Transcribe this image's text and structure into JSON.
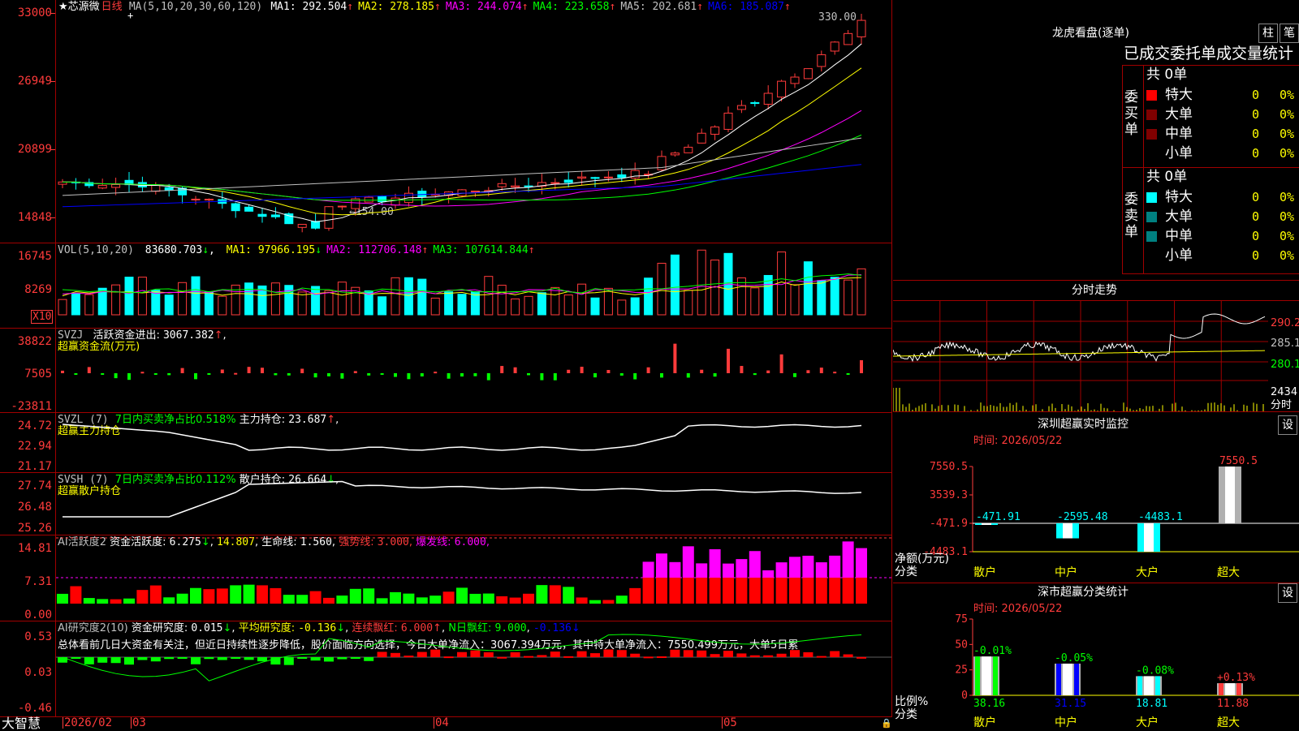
{
  "stock": {
    "name": "芯源微",
    "period": "日线",
    "star": "★"
  },
  "kline": {
    "ma_params": "MA(5,10,20,30,60,120)",
    "ma": [
      {
        "label": "MA1:",
        "value": "292.504",
        "arrow": "↑",
        "color": "#ffffff"
      },
      {
        "label": "MA2:",
        "value": "278.185",
        "arrow": "↑",
        "color": "#ffff00"
      },
      {
        "label": "MA3:",
        "value": "244.074",
        "arrow": "↑",
        "color": "#ff00ff"
      },
      {
        "label": "MA4:",
        "value": "223.658",
        "arrow": "↑",
        "color": "#00ff00"
      },
      {
        "label": "MA5:",
        "value": "202.681",
        "arrow": "↑",
        "color": "#c0c0c0"
      },
      {
        "label": "MA6:",
        "value": "185.087",
        "arrow": "↑",
        "color": "#0000ff"
      }
    ],
    "y_ticks": [
      "33000",
      "26949",
      "20899",
      "14848"
    ],
    "high_label": "330.00",
    "low_label": "←154.00"
  },
  "vol": {
    "title": "VOL(5,10,20)",
    "value": "83680.703",
    "value_arrow": "↓",
    "ma": [
      {
        "label": "MA1:",
        "value": "97966.195",
        "arrow": "↓",
        "color": "#ffff00"
      },
      {
        "label": "MA2:",
        "value": "112706.148",
        "arrow": "↑",
        "color": "#ff00ff"
      },
      {
        "label": "MA3:",
        "value": "107614.844",
        "arrow": "↑",
        "color": "#00ff00"
      }
    ],
    "y_ticks": [
      "16745",
      "8269"
    ],
    "unit": "X10"
  },
  "svzj": {
    "title": "SVZJ",
    "label": "活跃资金进出:",
    "value": "3067.382",
    "arrow": "↑",
    "sub": "超赢资金流(万元)",
    "y_ticks": [
      "38822",
      "7505",
      "-23811"
    ]
  },
  "svzl": {
    "title": "SVZL (7)",
    "green_text": "7日内买卖净占比0.518%",
    "label": "主力持仓:",
    "value": "23.687",
    "arrow": "↑",
    "sub": "超赢主力持仓",
    "y_ticks": [
      "24.72",
      "22.94",
      "21.17"
    ]
  },
  "svsh": {
    "title": "SVSH (7)",
    "green_text": "7日内买卖净占比0.112%",
    "label": "散户持仓:",
    "value": "26.664",
    "arrow": "↓",
    "sub": "超赢散户持仓",
    "y_ticks": [
      "27.74",
      "26.48",
      "25.26"
    ]
  },
  "ai_active": {
    "title": "AI活跃度2",
    "label": "资金活跃度:",
    "value1": "6.275",
    "arrow1": "↓",
    "value2": "14.807",
    "life_label": "生命线:",
    "life_value": "1.560",
    "strong_label": "强势线:",
    "strong_value": "3.000",
    "burst_label": "爆发线:",
    "burst_value": "6.000",
    "y_ticks": [
      "14.81",
      "7.31",
      "0.00"
    ]
  },
  "ai_research": {
    "title": "AI研究度2(10)",
    "label": "资金研究度:",
    "value": "0.015",
    "arrow": "↓",
    "avg_label": "平均研究度:",
    "avg_value": "-0.136",
    "avg_arrow": "↓",
    "red_label": "连续飘红:",
    "red_value": "6.000",
    "red_arrow": "↑",
    "nred_label": "N日飘红:",
    "nred_value": "9.000",
    "tail_value": "-0.136",
    "tail_arrow": "↓",
    "summary": "总体看前几日大资金有关注，但近日持续性逐步降低，股价面临方向选择，今日大单净流入：3067.394万元，其中特大单净流入：7550.499万元，大单5日累",
    "y_ticks": [
      "0.53",
      "0.03",
      "-0.46"
    ]
  },
  "footer": {
    "brand": "大智慧",
    "dates": [
      "2026/02",
      "03",
      "04",
      "05"
    ]
  },
  "lhb": {
    "title": "龙虎看盘(逐单)",
    "btn1": "柱",
    "btn2": "笔",
    "header": "已成交委托单成交量统计",
    "buy_label": "委买单",
    "sell_label": "委卖单",
    "buy_total": "共 0单",
    "sell_total": "共 0单",
    "buy_rows": [
      {
        "name": "特大",
        "count": "0",
        "pct": "0%",
        "color": "#ff0000"
      },
      {
        "name": "大单",
        "count": "0",
        "pct": "0%",
        "color": "#800000"
      },
      {
        "name": "中单",
        "count": "0",
        "pct": "0%",
        "color": "#800000"
      },
      {
        "name": "小单",
        "count": "0",
        "pct": "0%",
        "color": ""
      }
    ],
    "sell_rows": [
      {
        "name": "特大",
        "count": "0",
        "pct": "0%",
        "color": "#00ffff"
      },
      {
        "name": "大单",
        "count": "0",
        "pct": "0%",
        "color": "#008080"
      },
      {
        "name": "中单",
        "count": "0",
        "pct": "0%",
        "color": "#008080"
      },
      {
        "name": "小单",
        "count": "0",
        "pct": "0%",
        "color": ""
      }
    ]
  },
  "fenshi": {
    "title": "分时走势",
    "prices": [
      "290.2",
      "285.1",
      "280.1"
    ],
    "vol": "2434",
    "vol_unit": "分时"
  },
  "sz_monitor": {
    "title": "深圳超赢实时监控",
    "btn": "设",
    "time": "时间: 2026/05/22",
    "y_ticks": [
      "7550.5",
      "3539.3",
      "-471.9",
      "-4483.1"
    ],
    "net_label": "净额(万元)",
    "cat_label": "分类",
    "bars": [
      {
        "name": "散户",
        "value": "-471.91"
      },
      {
        "name": "中户",
        "value": "-2595.48"
      },
      {
        "name": "大户",
        "value": "-4483.1"
      },
      {
        "name": "超大",
        "value": "7550.5"
      }
    ]
  },
  "sz_class": {
    "title": "深市超赢分类统计",
    "btn": "设",
    "time": "时间: 2026/05/22",
    "y_ticks": [
      "75",
      "50",
      "25",
      "0"
    ],
    "ratio_label": "比例%",
    "cat_label": "分类",
    "bars": [
      {
        "name": "散户",
        "value": "38.16",
        "change": "-0.01%"
      },
      {
        "name": "中户",
        "value": "31.15",
        "change": "-0.05%"
      },
      {
        "name": "大户",
        "value": "18.81",
        "change": "-0.08%"
      },
      {
        "name": "超大",
        "value": "11.88",
        "change": "+0.13%"
      }
    ]
  }
}
